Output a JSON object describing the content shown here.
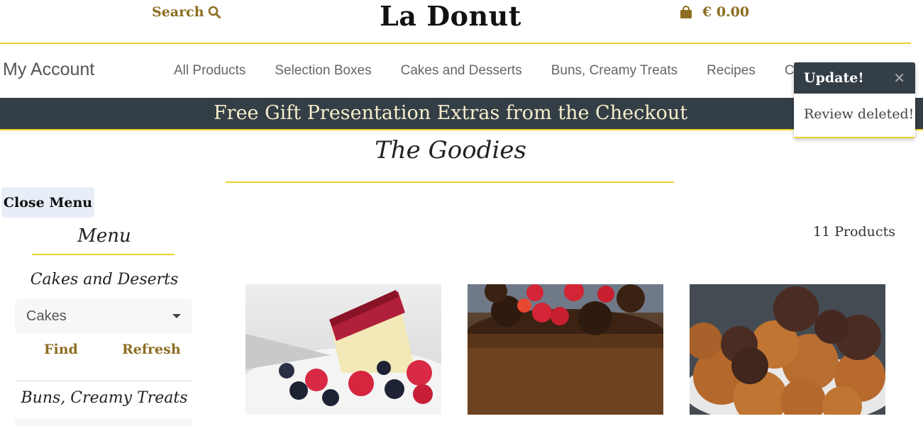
{
  "header": {
    "search_label": "Search",
    "brand": "La Donut",
    "cart_total": "€ 0.00"
  },
  "nav": {
    "account": "My Account",
    "links": [
      "All Products",
      "Selection Boxes",
      "Cakes and Desserts",
      "Buns, Creamy Treats",
      "Recipes",
      "C"
    ]
  },
  "banner": {
    "text": "Free Gift Presentation Extras from the Checkout"
  },
  "main": {
    "heading": "The Goodies",
    "product_count": "11 Products"
  },
  "sidebar": {
    "close_button": "Close Menu",
    "menu_title": "Menu",
    "category_1": "Cakes and Deserts",
    "select_value": "Cakes",
    "find": "Find",
    "refresh": "Refresh",
    "category_2": "Buns, Creamy Treats"
  },
  "toast": {
    "title": "Update!",
    "message": "Review deleted!"
  },
  "colors": {
    "gold": "#ecd02e",
    "link_brown": "#8c6d22",
    "banner": "#343e46"
  }
}
